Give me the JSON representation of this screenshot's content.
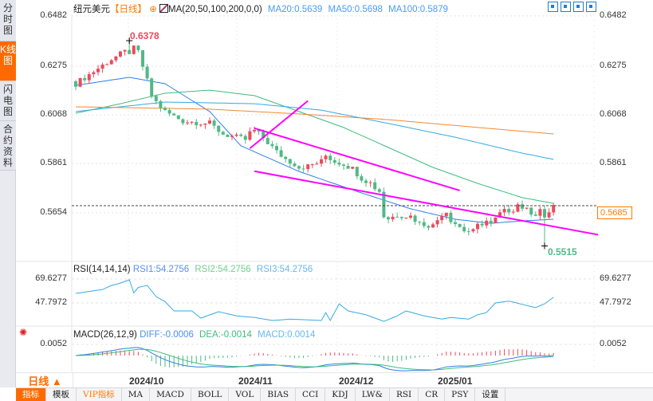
{
  "sidebar": {
    "tabs": [
      {
        "label": "分时图"
      },
      {
        "label": "K线图"
      },
      {
        "label": "闪电图"
      },
      {
        "label": "合约资料"
      }
    ]
  },
  "header": {
    "symbol": "纽元美元",
    "period": "【日线】",
    "ma_label": "MA(20,50,100,200,0,0)",
    "ma20": "MA20:0.5639",
    "ma50": "MA50:0.5698",
    "ma100": "MA100:0.5879"
  },
  "toolbar_icons": [
    "crosshair-icon",
    "fit-left-icon",
    "play-icon",
    "jump-end-icon"
  ],
  "price_axis": {
    "labels": [
      "0.6482",
      "0.6275",
      "0.6068",
      "0.5861",
      "0.5654"
    ],
    "current": "0.5685"
  },
  "annotations": {
    "high": "0.6378",
    "low": "0.5515"
  },
  "rsi": {
    "title": "RSI(14,14,14)",
    "rsi1": "RSI1:54.2756",
    "rsi2": "RSI2:54.2756",
    "rsi3": "RSI3:54.2756",
    "labels": [
      "69.6277",
      "47.7972"
    ]
  },
  "macd": {
    "title": "MACD(26,12,9)",
    "diff": "DIFF:-0.0006",
    "dea": "DEA:-0.0014",
    "macd": "MACD:0.0014",
    "labels": [
      "0.0052"
    ]
  },
  "xaxis": {
    "period": "日线 ▲",
    "dates": [
      "2024/10",
      "2024/11",
      "2024/12",
      "2025/01"
    ]
  },
  "bottom_toolbar": [
    "指标",
    "模板",
    "VIP指标",
    "MA",
    "MACD",
    "BOLL",
    "VOL",
    "BIAS",
    "CCI",
    "KDJ",
    "LW&",
    "RSI",
    "CR",
    "PSY",
    "设置"
  ],
  "colors": {
    "up": "#ec4a5c",
    "down": "#4fb985",
    "ma20": "#2f7fe6",
    "ma50": "#3dbd7d",
    "ma100": "#36a9e1",
    "ma200": "#f08a30",
    "trend": "#ff00ff",
    "accent": "#ff6a00"
  },
  "chart_data": {
    "type": "candlestick",
    "ylim": [
      0.5654,
      0.6482
    ],
    "candle_count": 108,
    "close_anchors": [
      [
        0,
        0.6197
      ],
      [
        8,
        0.63
      ],
      [
        11,
        0.6331
      ],
      [
        12,
        0.633
      ],
      [
        13,
        0.6345
      ],
      [
        14,
        0.633
      ],
      [
        15,
        0.627
      ],
      [
        17,
        0.6147
      ],
      [
        18,
        0.612
      ],
      [
        20,
        0.608
      ],
      [
        24,
        0.604
      ],
      [
        30,
        0.603
      ],
      [
        33,
        0.5985
      ],
      [
        38,
        0.5962
      ],
      [
        39,
        0.599
      ],
      [
        40,
        0.6
      ],
      [
        42,
        0.597
      ],
      [
        43,
        0.595
      ],
      [
        45,
        0.591
      ],
      [
        47,
        0.588
      ],
      [
        49,
        0.586
      ],
      [
        50,
        0.5845
      ],
      [
        52,
        0.585
      ],
      [
        55,
        0.587
      ],
      [
        56,
        0.5895
      ],
      [
        58,
        0.587
      ],
      [
        60,
        0.586
      ],
      [
        62,
        0.584
      ],
      [
        64,
        0.58
      ],
      [
        66,
        0.578
      ],
      [
        67,
        0.576
      ],
      [
        68,
        0.5745
      ],
      [
        69,
        0.564
      ],
      [
        70,
        0.563
      ],
      [
        72,
        0.5645
      ],
      [
        75,
        0.564
      ],
      [
        77,
        0.561
      ],
      [
        80,
        0.56
      ],
      [
        82,
        0.565
      ],
      [
        83,
        0.566
      ],
      [
        84,
        0.5625
      ],
      [
        85,
        0.561
      ],
      [
        87,
        0.558
      ],
      [
        89,
        0.5575
      ],
      [
        90,
        0.56
      ],
      [
        92,
        0.562
      ],
      [
        93,
        0.5605
      ],
      [
        95,
        0.565
      ],
      [
        96,
        0.566
      ],
      [
        98,
        0.567
      ],
      [
        99,
        0.569
      ],
      [
        101,
        0.5665
      ],
      [
        103,
        0.565
      ],
      [
        104,
        0.567
      ],
      [
        105,
        0.5625
      ],
      [
        106,
        0.566
      ],
      [
        107,
        0.5685
      ]
    ],
    "high_point": {
      "index": 12,
      "value": 0.6378
    },
    "low_point": {
      "index": 105,
      "value": 0.5515
    },
    "ma": {
      "ma20": [
        [
          0,
          0.619
        ],
        [
          12,
          0.6224
        ],
        [
          20,
          0.6197
        ],
        [
          30,
          0.608
        ],
        [
          37,
          0.5936
        ],
        [
          50,
          0.5828
        ],
        [
          63,
          0.5744
        ],
        [
          75,
          0.5671
        ],
        [
          85,
          0.5627
        ],
        [
          93,
          0.561
        ],
        [
          100,
          0.562
        ],
        [
          107,
          0.5627
        ]
      ],
      "ma50": [
        [
          0,
          0.6073
        ],
        [
          10,
          0.6113
        ],
        [
          20,
          0.6157
        ],
        [
          30,
          0.617
        ],
        [
          40,
          0.6147
        ],
        [
          50,
          0.608
        ],
        [
          60,
          0.6013
        ],
        [
          70,
          0.5929
        ],
        [
          80,
          0.5845
        ],
        [
          90,
          0.5778
        ],
        [
          100,
          0.5718
        ],
        [
          107,
          0.5694
        ]
      ],
      "ma100": [
        [
          0,
          0.608
        ],
        [
          20,
          0.612
        ],
        [
          40,
          0.6113
        ],
        [
          55,
          0.6086
        ],
        [
          70,
          0.603
        ],
        [
          85,
          0.5972
        ],
        [
          100,
          0.5905
        ],
        [
          107,
          0.5879
        ]
      ],
      "ma200": [
        [
          0,
          0.61
        ],
        [
          30,
          0.609
        ],
        [
          50,
          0.607
        ],
        [
          70,
          0.6046
        ],
        [
          90,
          0.6013
        ],
        [
          107,
          0.5986
        ]
      ]
    },
    "trendlines": [
      [
        [
          39,
          0.5925
        ],
        [
          52,
          0.6125
        ]
      ],
      [
        [
          40,
          0.601
        ],
        [
          86,
          0.5748
        ]
      ],
      [
        [
          40,
          0.5829
        ],
        [
          117,
          0.5562
        ]
      ]
    ],
    "rsi_anchors": [
      [
        0,
        56.5
      ],
      [
        6,
        60
      ],
      [
        8,
        63.8
      ],
      [
        10,
        65.9
      ],
      [
        12,
        69
      ],
      [
        13,
        57
      ],
      [
        14,
        62
      ],
      [
        16,
        63.8
      ],
      [
        18,
        53.6
      ],
      [
        20,
        49
      ],
      [
        22,
        40.5
      ],
      [
        26,
        40.5
      ],
      [
        28,
        34
      ],
      [
        32,
        39.8
      ],
      [
        36,
        36
      ],
      [
        40,
        34.6
      ],
      [
        44,
        31.8
      ],
      [
        48,
        33
      ],
      [
        55,
        31.8
      ],
      [
        56,
        39
      ],
      [
        57,
        31.8
      ],
      [
        59,
        47
      ],
      [
        61,
        40.5
      ],
      [
        65,
        37
      ],
      [
        69,
        31
      ],
      [
        72,
        36
      ],
      [
        74,
        40.5
      ],
      [
        78,
        36
      ],
      [
        82,
        33
      ],
      [
        84,
        34.5
      ],
      [
        88,
        33
      ],
      [
        90,
        37
      ],
      [
        92,
        39
      ],
      [
        94,
        47.8
      ],
      [
        97,
        49.5
      ],
      [
        100,
        46.5
      ],
      [
        103,
        43.5
      ],
      [
        105,
        47
      ],
      [
        107,
        53
      ]
    ]
  }
}
